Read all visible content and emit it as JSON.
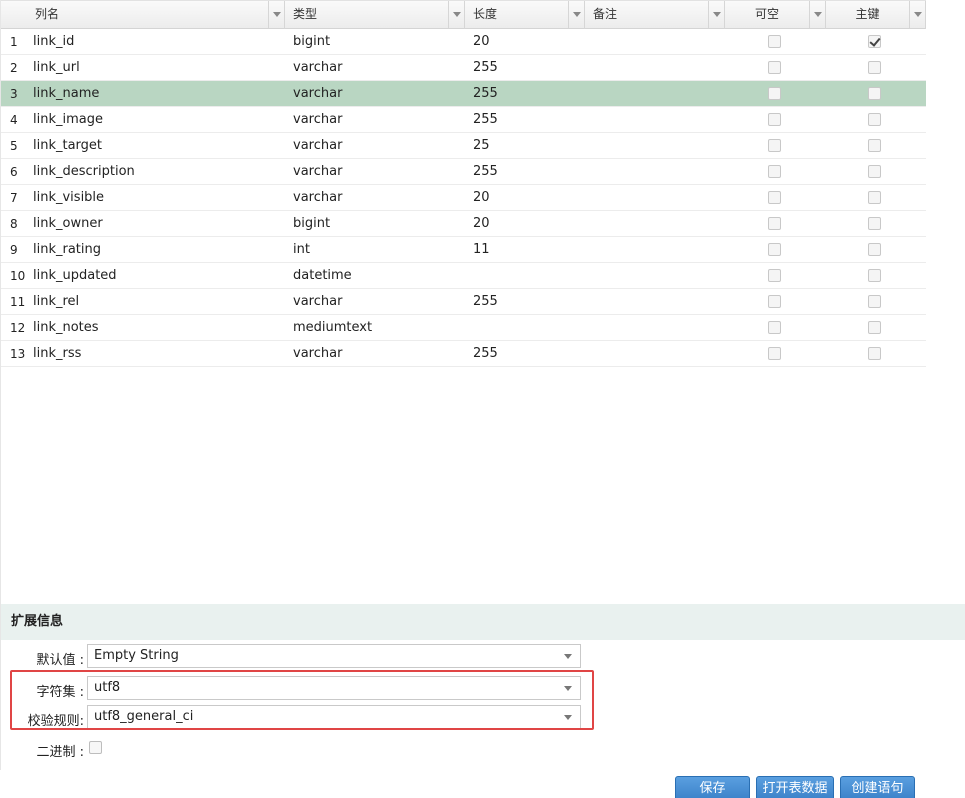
{
  "columns": {
    "name": "列名",
    "type": "类型",
    "length": "长度",
    "comment": "备注",
    "nullable": "可空",
    "primary_key": "主键"
  },
  "rows": [
    {
      "idx": "1",
      "name": "link_id",
      "type": "bigint",
      "length": "20",
      "nullable": false,
      "pk": true,
      "selected": false
    },
    {
      "idx": "2",
      "name": "link_url",
      "type": "varchar",
      "length": "255",
      "nullable": false,
      "pk": false,
      "selected": false
    },
    {
      "idx": "3",
      "name": "link_name",
      "type": "varchar",
      "length": "255",
      "nullable": false,
      "pk": false,
      "selected": true
    },
    {
      "idx": "4",
      "name": "link_image",
      "type": "varchar",
      "length": "255",
      "nullable": false,
      "pk": false,
      "selected": false
    },
    {
      "idx": "5",
      "name": "link_target",
      "type": "varchar",
      "length": "25",
      "nullable": false,
      "pk": false,
      "selected": false
    },
    {
      "idx": "6",
      "name": "link_description",
      "type": "varchar",
      "length": "255",
      "nullable": false,
      "pk": false,
      "selected": false
    },
    {
      "idx": "7",
      "name": "link_visible",
      "type": "varchar",
      "length": "20",
      "nullable": false,
      "pk": false,
      "selected": false
    },
    {
      "idx": "8",
      "name": "link_owner",
      "type": "bigint",
      "length": "20",
      "nullable": false,
      "pk": false,
      "selected": false
    },
    {
      "idx": "9",
      "name": "link_rating",
      "type": "int",
      "length": "11",
      "nullable": false,
      "pk": false,
      "selected": false
    },
    {
      "idx": "10",
      "name": "link_updated",
      "type": "datetime",
      "length": "",
      "nullable": false,
      "pk": false,
      "selected": false
    },
    {
      "idx": "11",
      "name": "link_rel",
      "type": "varchar",
      "length": "255",
      "nullable": false,
      "pk": false,
      "selected": false
    },
    {
      "idx": "12",
      "name": "link_notes",
      "type": "mediumtext",
      "length": "",
      "nullable": false,
      "pk": false,
      "selected": false
    },
    {
      "idx": "13",
      "name": "link_rss",
      "type": "varchar",
      "length": "255",
      "nullable": false,
      "pk": false,
      "selected": false
    }
  ],
  "extended": {
    "title": "扩展信息",
    "default_label": "默认值 :",
    "default_value": "Empty String",
    "charset_label": "字符集 :",
    "charset_value": "utf8",
    "collation_label": "校验规则:",
    "collation_value": "utf8_general_ci",
    "binary_label": "二进制 :"
  },
  "buttons": {
    "save": "保存",
    "open_data": "打开表数据",
    "create_sql": "创建语句"
  },
  "colors": {
    "selected_row": "#b9d6c2",
    "highlight_border": "#e04545",
    "button": "#3a80c8"
  }
}
